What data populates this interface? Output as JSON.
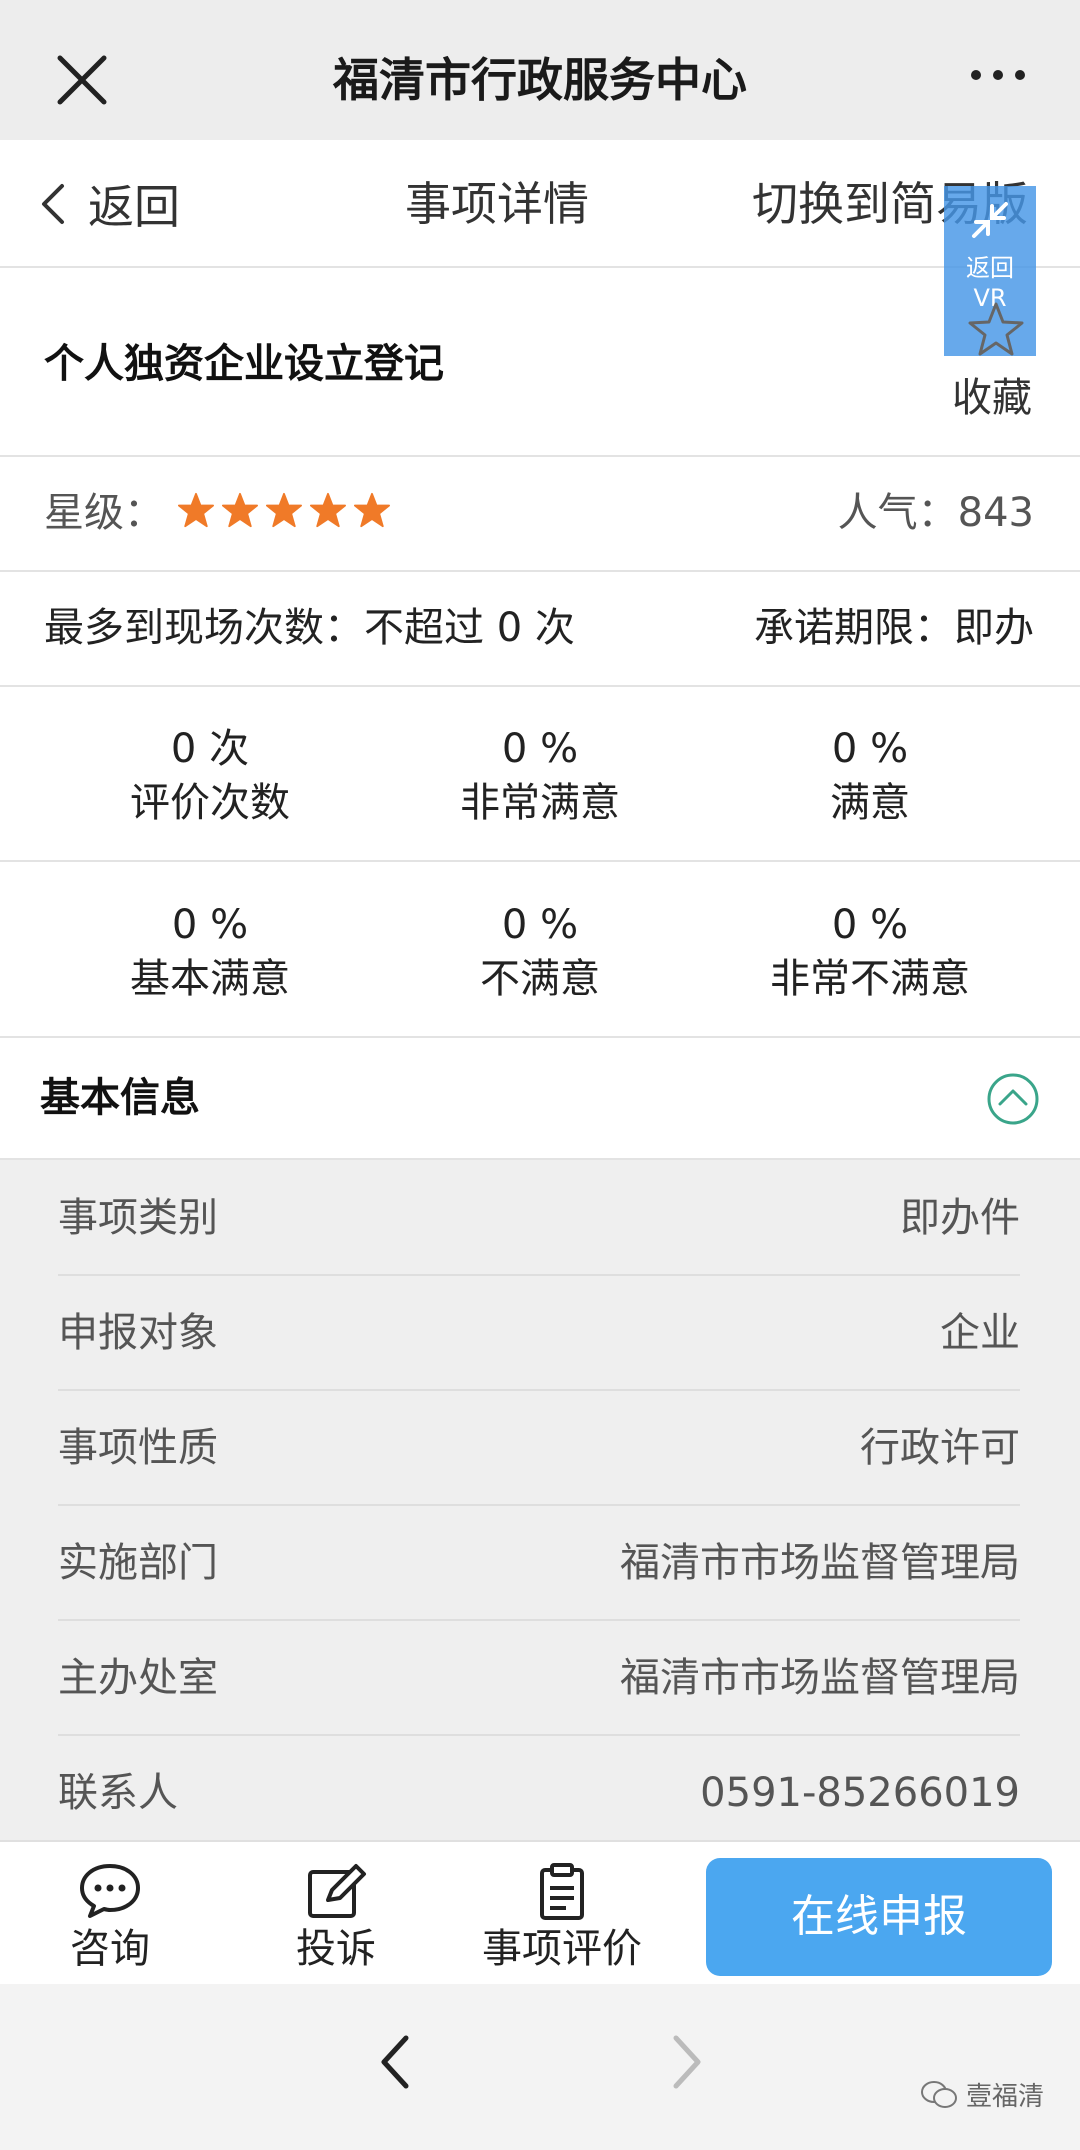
{
  "wechat": {
    "title": "福清市行政服务中心"
  },
  "nav": {
    "back": "返回",
    "title": "事项详情",
    "switch": "切换到简易版"
  },
  "vr": {
    "line1": "返回",
    "line2": "VR"
  },
  "item": {
    "title": "个人独资企业设立登记",
    "favorite": "收藏"
  },
  "rating": {
    "label": "星级：",
    "stars": 5,
    "star_color": "#f07a28",
    "popularity": "人气：843"
  },
  "visits": {
    "label": "最多到现场次数：不超过 0 次",
    "promise": "承诺期限：即办"
  },
  "stats": [
    {
      "value": "0 次",
      "label": "评价次数"
    },
    {
      "value": "0 %",
      "label": "非常满意"
    },
    {
      "value": "0 %",
      "label": "满意"
    },
    {
      "value": "0 %",
      "label": "基本满意"
    },
    {
      "value": "0 %",
      "label": "不满意"
    },
    {
      "value": "0 %",
      "label": "非常不满意"
    }
  ],
  "basic": {
    "title": "基本信息",
    "rows": [
      {
        "key": "事项类别",
        "value": "即办件"
      },
      {
        "key": "申报对象",
        "value": "企业"
      },
      {
        "key": "事项性质",
        "value": "行政许可"
      },
      {
        "key": "实施部门",
        "value": "福清市市场监督管理局"
      },
      {
        "key": "主办处室",
        "value": "福清市市场监督管理局"
      },
      {
        "key": "联系人",
        "value": "0591-85266019"
      }
    ]
  },
  "actions": {
    "consult": "咨询",
    "complain": "投诉",
    "evaluate": "事项评价",
    "apply": "在线申报"
  },
  "footer": {
    "watermark": "壹福清"
  },
  "colors": {
    "accent": "#4ba7f0",
    "collapse": "#3aa58a"
  }
}
